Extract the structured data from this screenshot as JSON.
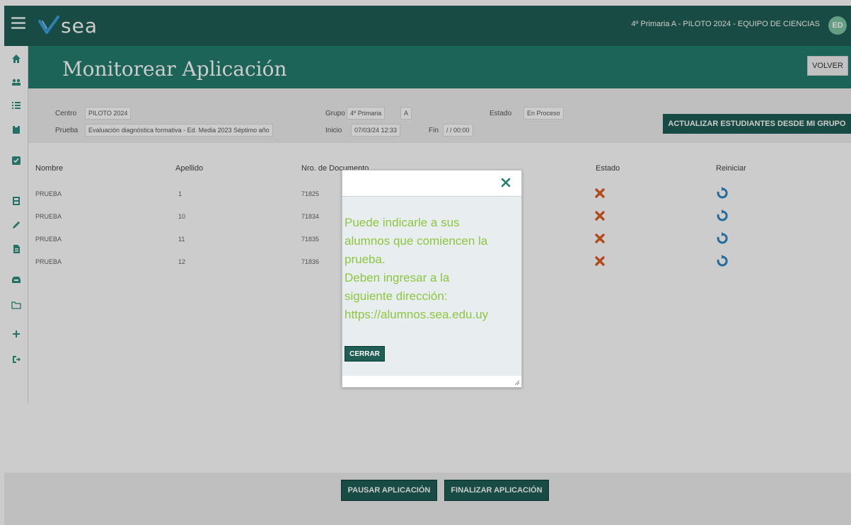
{
  "topbar": {
    "logo_text": "sea",
    "context": "4º Primaria A - PILOTO 2024 - EQUIPO DE CIENCIAS",
    "avatar_initials": "ED",
    "colors": {
      "bar": "#1f5e54",
      "avatar": "#7fc6a4"
    }
  },
  "sidebar": {
    "icons": [
      "home-icon",
      "users-icon",
      "list-icon",
      "clipboard-icon",
      "checkbox-icon",
      "save-icon",
      "pencil-icon",
      "document-icon",
      "inbox-icon",
      "folder-icon",
      "plus-icon",
      "logout-icon"
    ]
  },
  "page": {
    "title": "Monitorear Aplicación",
    "back_label": "VOLVER",
    "accent": "#247d6e"
  },
  "info": {
    "centro_label": "Centro",
    "centro_value": "PILOTO 2024",
    "grupo_label": "Grupo",
    "grupo_value": "4º Primaria",
    "grupo_letter": "A",
    "estado_label": "Estado",
    "estado_value": "En Proceso",
    "prueba_label": "Prueba",
    "prueba_value": "Evaluación diagnóstica formativa - Ed. Media 2023 Séptimo año",
    "inicio_label": "Inicio",
    "inicio_value": "07/03/24 12:33",
    "fin_label": "Fin",
    "fin_value": "/ / 00:00",
    "update_button": "ACTUALIZAR ESTUDIANTES DESDE MI GRUPO"
  },
  "table": {
    "headers": {
      "nombre": "Nombre",
      "apellido": "Apellido",
      "documento": "Nro. de Documento",
      "estado": "Estado",
      "reiniciar": "Reiniciar"
    },
    "rows": [
      {
        "nombre": "PRUEBA",
        "apellido": "1",
        "documento": "71825"
      },
      {
        "nombre": "PRUEBA",
        "apellido": "10",
        "documento": "71834"
      },
      {
        "nombre": "PRUEBA",
        "apellido": "11",
        "documento": "71835"
      },
      {
        "nombre": "PRUEBA",
        "apellido": "12",
        "documento": "71836"
      }
    ],
    "status_icon": "x-mark-icon",
    "status_color": "#e05a1e",
    "reset_icon": "refresh-icon",
    "reset_color": "#2e86c9"
  },
  "footer": {
    "pause_label": "PAUSAR APLICACIÓN",
    "finish_label": "FINALIZAR APLICACIÓN"
  },
  "modal": {
    "close_icon": "close-icon",
    "message_lines": [
      "Puede indicarle a sus",
      "alumnos que comiencen la",
      "prueba.",
      "Deben ingresar a la",
      "siguiente dirección:",
      "https://alumnos.sea.edu.uy"
    ],
    "message_color": "#8dc63f",
    "close_label": "CERRAR"
  }
}
